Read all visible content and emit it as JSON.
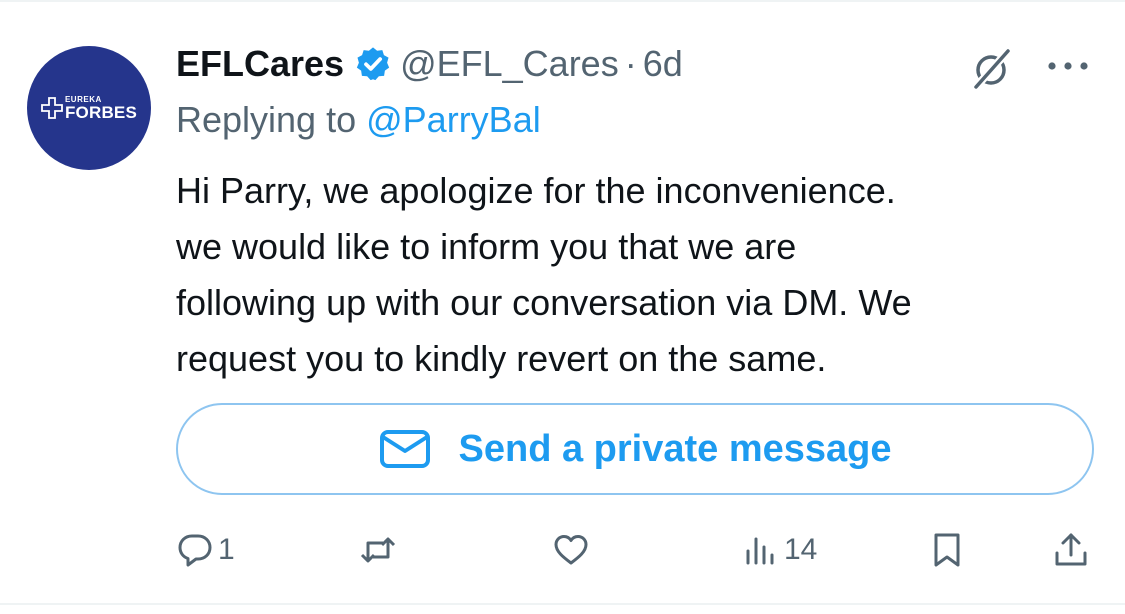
{
  "tweet": {
    "author": {
      "display_name": "EFLCares",
      "handle": "@EFL_Cares",
      "verified": true,
      "avatar": {
        "logo_top": "EUREKA",
        "logo_bottom": "FORBES",
        "background_color": "#25358c"
      }
    },
    "separator": "·",
    "time": "6d",
    "replying_to_prefix": "Replying to",
    "replying_to_handle": "@ParryBal",
    "text_lines": [
      "Hi Parry, we apologize for the inconvenience.",
      "we would like to inform you that we are",
      "following up with our conversation via DM. We",
      "request you to kindly revert on the same."
    ],
    "dm_button_label": "Send a private message",
    "actions": {
      "reply_count": "1",
      "repost_count": "",
      "like_count": "",
      "views_count": "14"
    },
    "icons": {
      "verified": "verified-badge-icon",
      "grok": "grok-icon",
      "more": "more-dots-icon",
      "mail": "envelope-icon",
      "reply": "reply-bubble-icon",
      "repost": "repost-icon",
      "like": "heart-icon",
      "views": "analytics-bars-icon",
      "bookmark": "bookmark-icon",
      "share": "share-upload-icon"
    },
    "colors": {
      "accent": "#1d9bf0",
      "secondary_text": "#536471",
      "primary_text": "#0f1419"
    }
  }
}
